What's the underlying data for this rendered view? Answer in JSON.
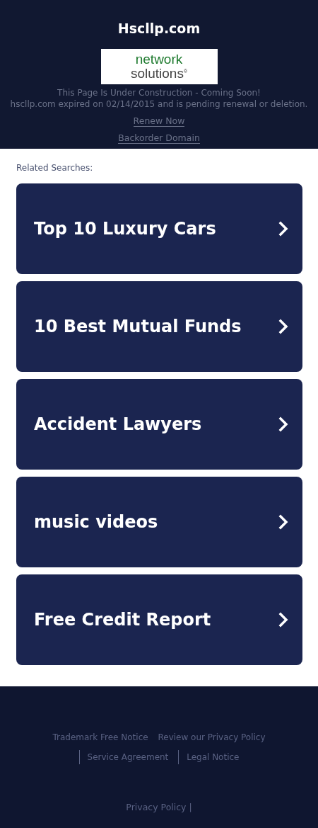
{
  "header": {
    "title": "Hscllp.com",
    "logo": {
      "line_1": "network",
      "line_2": "solutions",
      "mark": "®"
    },
    "message_lines": [
      "This Page Is Under Construction - Coming Soon!",
      "hscllp.com expired on 02/14/2015 and is pending renewal or deletion."
    ],
    "links": [
      "Renew Now",
      "Backorder Domain"
    ]
  },
  "related": {
    "label": "Related Searches:",
    "items": [
      {
        "text": "Top 10 Luxury Cars"
      },
      {
        "text": "10 Best Mutual Funds"
      },
      {
        "text": "Accident Lawyers"
      },
      {
        "text": "music videos"
      },
      {
        "text": "Free Credit Report"
      }
    ]
  },
  "footer": {
    "links": [
      {
        "text": "Trademark Free Notice",
        "separator": false
      },
      {
        "text": "Review our Privacy Policy",
        "separator": false
      },
      {
        "text": "Service Agreement",
        "separator": true
      },
      {
        "text": "Legal Notice",
        "separator": true
      }
    ],
    "bottom_link": "Privacy Policy |"
  }
}
